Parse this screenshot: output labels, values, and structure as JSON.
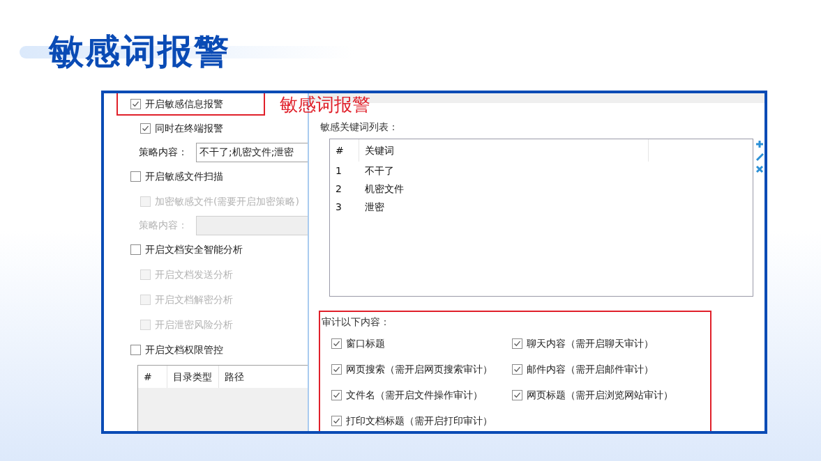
{
  "title": "敏感词报警",
  "annotation": "敏感词报警",
  "left_panel": {
    "options": [
      {
        "kind": "checkbox",
        "label": "开启敏感信息报警",
        "checked": true,
        "disabled": false,
        "highlighted": true,
        "children": [
          {
            "kind": "checkbox",
            "label": "同时在终端报警",
            "checked": true,
            "disabled": false
          },
          {
            "kind": "field",
            "label": "策略内容：",
            "value": "不干了;机密文件;泄密",
            "disabled": false
          }
        ]
      },
      {
        "kind": "checkbox",
        "label": "开启敏感文件扫描",
        "checked": false,
        "disabled": false,
        "highlighted": false,
        "children": [
          {
            "kind": "checkbox",
            "label": "加密敏感文件(需要开启加密策略)",
            "checked": false,
            "disabled": true
          },
          {
            "kind": "field",
            "label": "策略内容：",
            "disabled": true
          }
        ]
      },
      {
        "kind": "checkbox",
        "label": "开启文档安全智能分析",
        "checked": false,
        "disabled": false,
        "highlighted": false,
        "children": [
          {
            "kind": "checkbox",
            "label": "开启文档发送分析",
            "checked": false,
            "disabled": true
          },
          {
            "kind": "checkbox",
            "label": "开启文档解密分析",
            "checked": false,
            "disabled": true
          },
          {
            "kind": "checkbox",
            "label": "开启泄密风险分析",
            "checked": false,
            "disabled": true
          }
        ]
      },
      {
        "kind": "checkbox",
        "label": "开启文档权限管控",
        "checked": false,
        "disabled": false,
        "highlighted": false,
        "children": [
          {
            "kind": "table",
            "columns": [
              "#",
              "目录类型",
              "路径"
            ]
          }
        ]
      }
    ]
  },
  "right_panel": {
    "keyword_list": {
      "label": "敏感关键词列表：",
      "columns": [
        "#",
        "关键词"
      ],
      "rows": [
        [
          "1",
          "不干了"
        ],
        [
          "2",
          "机密文件"
        ],
        [
          "3",
          "泄密"
        ]
      ]
    },
    "audit": {
      "label": "审计以下内容：",
      "highlighted": true,
      "options": [
        {
          "label": "窗口标题",
          "checked": true
        },
        {
          "label": "聊天内容（需开启聊天审计）",
          "checked": true
        },
        {
          "label": "网页搜索（需开启网页搜索审计）",
          "checked": true
        },
        {
          "label": "邮件内容（需开启邮件审计）",
          "checked": true
        },
        {
          "label": "文件名（需开启文件操作审计）",
          "checked": true
        },
        {
          "label": "网页标题（需开启浏览网站审计）",
          "checked": true
        },
        {
          "label": "打印文档标题（需开启打印审计）",
          "checked": true
        }
      ]
    }
  }
}
